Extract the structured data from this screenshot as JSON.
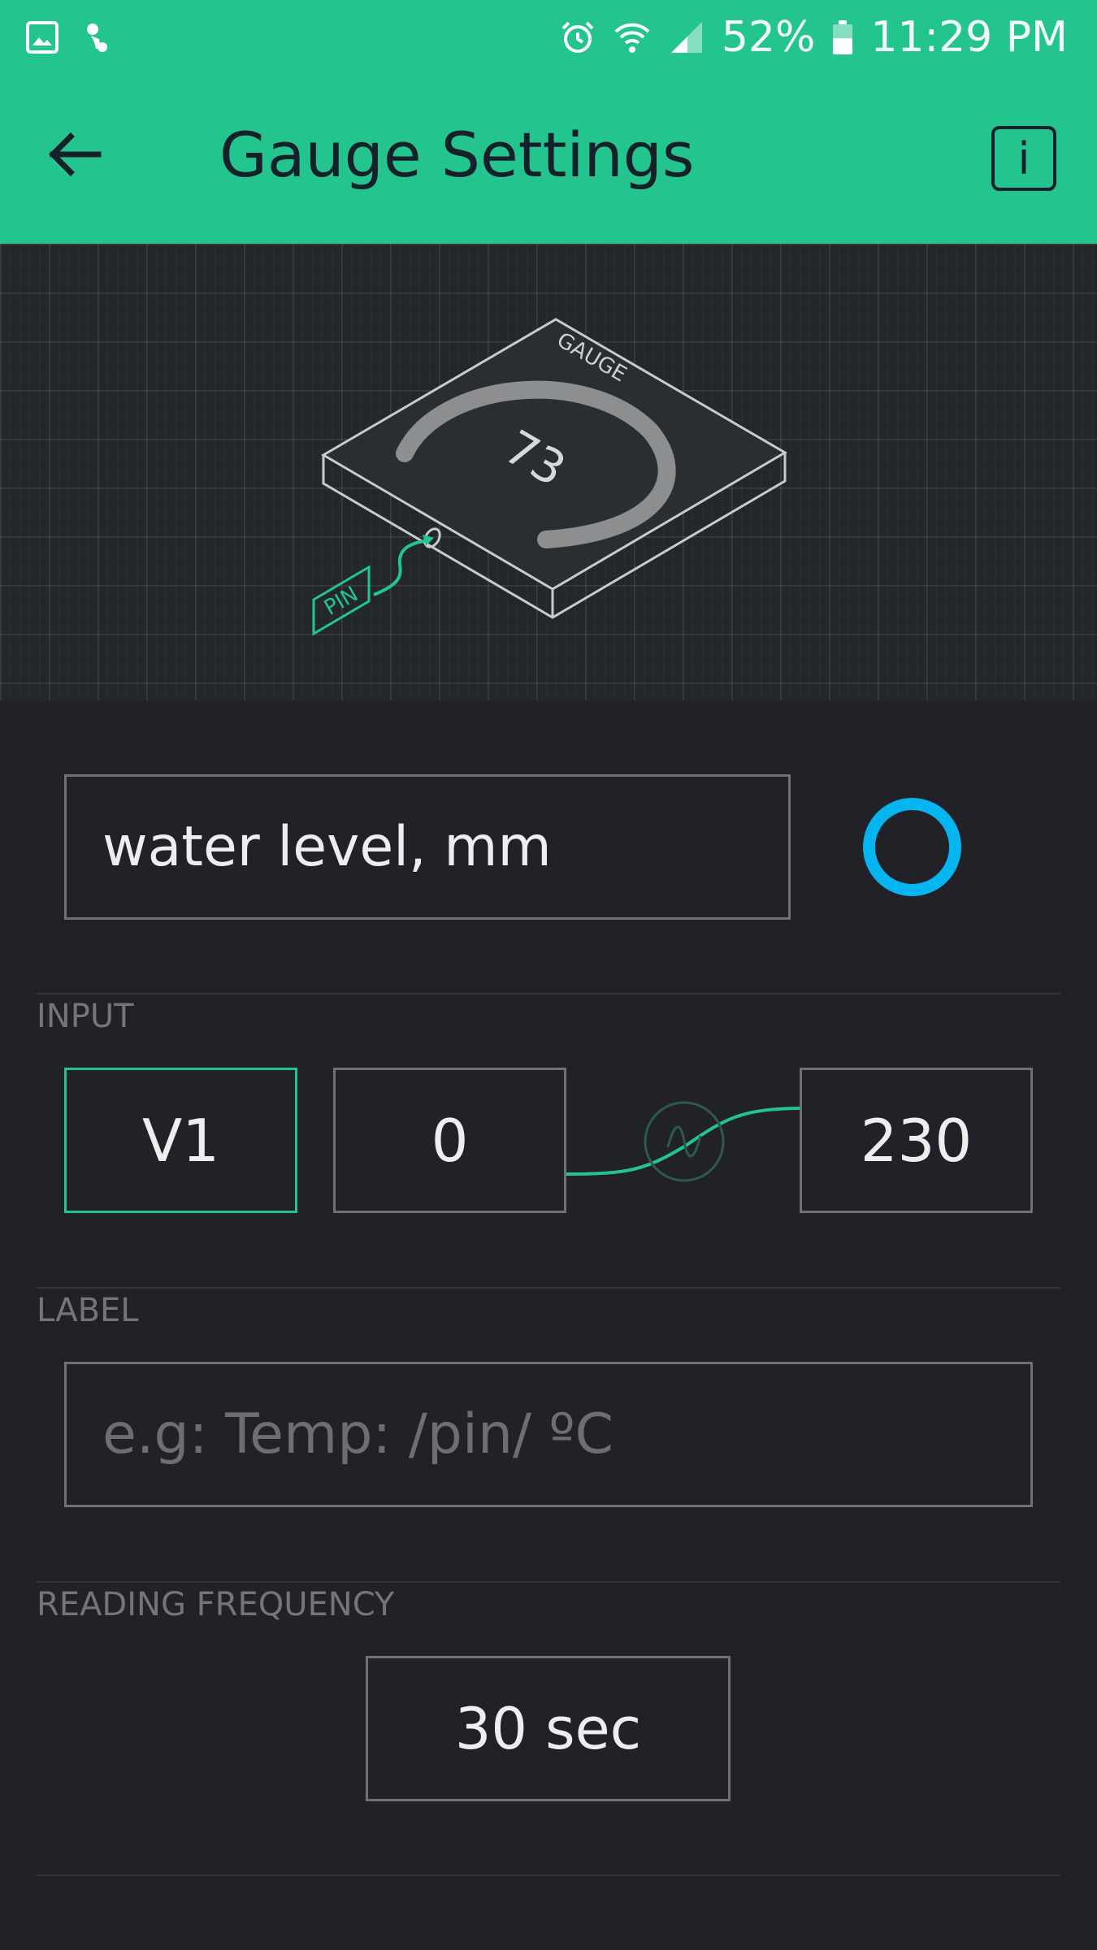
{
  "status_bar": {
    "battery": "52%",
    "time": "11:29 PM"
  },
  "header": {
    "title": "Gauge Settings",
    "info_label": "i"
  },
  "preview": {
    "widget_label": "GAUGE",
    "gauge_value": "73",
    "pin_tag": "PIN"
  },
  "name_field": {
    "value": "water level, mm",
    "color": "#04b5f0"
  },
  "input": {
    "section_label": "INPUT",
    "pin": "V1",
    "min": "0",
    "max": "230"
  },
  "label": {
    "section_label": "LABEL",
    "placeholder": "e.g: Temp: /pin/ ºC"
  },
  "reading_frequency": {
    "section_label": "READING FREQUENCY",
    "value": "30 sec"
  },
  "colors": {
    "accent": "#23c48e",
    "background": "#212227",
    "widget_color": "#04b5f0"
  }
}
